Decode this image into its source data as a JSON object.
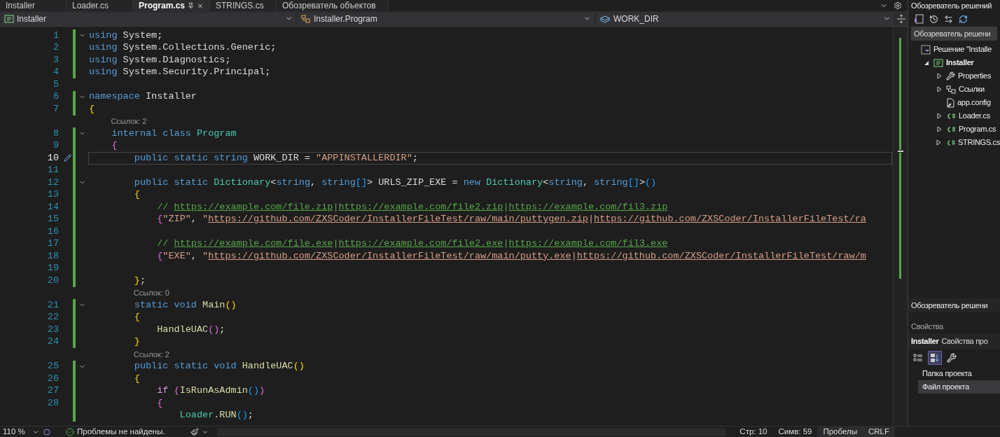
{
  "tabs": [
    {
      "label": "Installer",
      "selected": false
    },
    {
      "label": "Loader.cs",
      "selected": false
    },
    {
      "label": "Program.cs",
      "selected": true
    },
    {
      "label": "STRINGS.cs",
      "selected": false
    },
    {
      "label": "Обозреватель объектов",
      "selected": false
    }
  ],
  "nav": {
    "project": "Installer",
    "class": "Installer.Program",
    "member": "WORK_DIR"
  },
  "code": [
    {
      "kind": "line",
      "num": "1",
      "current": false,
      "changed": true,
      "foldable": true,
      "tokens": [
        {
          "kind": "kw",
          "text": "using"
        },
        {
          "kind": "plain",
          "text": " System;"
        }
      ]
    },
    {
      "kind": "line",
      "num": "2",
      "current": false,
      "changed": true,
      "foldable": false,
      "tokens": [
        {
          "kind": "kw",
          "text": "using"
        },
        {
          "kind": "plain",
          "text": " System.Collections.Generic;"
        }
      ]
    },
    {
      "kind": "line",
      "num": "3",
      "current": false,
      "changed": true,
      "foldable": false,
      "tokens": [
        {
          "kind": "kw",
          "text": "using"
        },
        {
          "kind": "plain",
          "text": " System.Diagnostics;"
        }
      ]
    },
    {
      "kind": "line",
      "num": "4",
      "current": false,
      "changed": true,
      "foldable": false,
      "tokens": [
        {
          "kind": "kw",
          "text": "using"
        },
        {
          "kind": "plain",
          "text": " System.Security.Principal;"
        }
      ]
    },
    {
      "kind": "line",
      "num": "5",
      "current": false,
      "changed": false,
      "foldable": false
    },
    {
      "kind": "line",
      "num": "6",
      "current": false,
      "changed": true,
      "foldable": true,
      "tokens": [
        {
          "kind": "kw",
          "text": "namespace"
        },
        {
          "kind": "plain",
          "text": " Installer"
        }
      ]
    },
    {
      "kind": "line",
      "num": "7",
      "current": false,
      "changed": true,
      "foldable": false,
      "tokens": [
        {
          "kind": "brace1",
          "text": "{"
        }
      ]
    },
    {
      "kind": "lens",
      "text": "    Ссылок: 2"
    },
    {
      "kind": "line",
      "num": "8",
      "current": false,
      "changed": true,
      "foldable": true,
      "tokens": [
        {
          "kind": "kw",
          "text": "    internal class"
        },
        {
          "kind": "type",
          "text": " Program"
        }
      ]
    },
    {
      "kind": "line",
      "num": "9",
      "current": false,
      "changed": true,
      "foldable": false,
      "tokens": [
        {
          "kind": "brace2",
          "text": "    {"
        }
      ]
    },
    {
      "kind": "line",
      "num": "10",
      "current": true,
      "changed": true,
      "foldable": false,
      "tokens": [
        {
          "kind": "kw",
          "text": "        public static string"
        },
        {
          "kind": "plain",
          "text": " WORK_DIR = "
        },
        {
          "kind": "str",
          "text": "\"APPINSTALLERDIR\""
        },
        {
          "kind": "plain",
          "text": ";"
        }
      ]
    },
    {
      "kind": "line",
      "num": "11",
      "current": false,
      "changed": true,
      "foldable": false
    },
    {
      "kind": "line",
      "num": "12",
      "current": false,
      "changed": true,
      "foldable": true,
      "tokens": [
        {
          "kind": "kw",
          "text": "        public static"
        },
        {
          "kind": "type",
          "text": " Dictionary"
        },
        {
          "kind": "plain",
          "text": "<"
        },
        {
          "kind": "kw",
          "text": "string"
        },
        {
          "kind": "plain",
          "text": ", "
        },
        {
          "kind": "kw",
          "text": "string"
        },
        {
          "kind": "brace3",
          "text": "[]"
        },
        {
          "kind": "plain",
          "text": "> URLS_ZIP_EXE = "
        },
        {
          "kind": "kw",
          "text": "new"
        },
        {
          "kind": "type",
          "text": " Dictionary"
        },
        {
          "kind": "plain",
          "text": "<"
        },
        {
          "kind": "kw",
          "text": "string"
        },
        {
          "kind": "plain",
          "text": ", "
        },
        {
          "kind": "kw",
          "text": "string"
        },
        {
          "kind": "brace3",
          "text": "[]"
        },
        {
          "kind": "plain",
          "text": ">"
        },
        {
          "kind": "brace3",
          "text": "()"
        }
      ]
    },
    {
      "kind": "line",
      "num": "13",
      "current": false,
      "changed": true,
      "foldable": false,
      "tokens": [
        {
          "kind": "brace1",
          "text": "        {"
        }
      ]
    },
    {
      "kind": "line",
      "num": "14",
      "current": false,
      "changed": true,
      "foldable": false,
      "tokens": [
        {
          "kind": "comment",
          "text": "            // "
        },
        {
          "kind": "clink",
          "text": "https://example.com/file.zip"
        },
        {
          "kind": "comment",
          "text": "|"
        },
        {
          "kind": "clink",
          "text": "https://example.com/file2.zip"
        },
        {
          "kind": "comment",
          "text": "|"
        },
        {
          "kind": "clink",
          "text": "https://example.com/fil3.zip"
        }
      ]
    },
    {
      "kind": "line",
      "num": "15",
      "current": false,
      "changed": true,
      "foldable": false,
      "tokens": [
        {
          "kind": "brace2",
          "text": "            {"
        },
        {
          "kind": "str",
          "text": "\"ZIP\""
        },
        {
          "kind": "plain",
          "text": ", "
        },
        {
          "kind": "str",
          "text": "\""
        },
        {
          "kind": "slink",
          "text": "https://github.com/ZXSCoder/InstallerFileTest/raw/main/puttygen.zip"
        },
        {
          "kind": "str",
          "text": "|"
        },
        {
          "kind": "slink",
          "text": "https://github.com/ZXSCoder/InstallerFileTest/ra"
        }
      ]
    },
    {
      "kind": "line",
      "num": "16",
      "current": false,
      "changed": true,
      "foldable": false
    },
    {
      "kind": "line",
      "num": "17",
      "current": false,
      "changed": true,
      "foldable": false,
      "tokens": [
        {
          "kind": "comment",
          "text": "            // "
        },
        {
          "kind": "clink",
          "text": "https://example.com/file.exe"
        },
        {
          "kind": "comment",
          "text": "|"
        },
        {
          "kind": "clink",
          "text": "https://example.com/file2.exe"
        },
        {
          "kind": "comment",
          "text": "|"
        },
        {
          "kind": "clink",
          "text": "https://example.com/fil3.exe"
        }
      ]
    },
    {
      "kind": "line",
      "num": "18",
      "current": false,
      "changed": true,
      "foldable": false,
      "tokens": [
        {
          "kind": "brace2",
          "text": "            {"
        },
        {
          "kind": "str",
          "text": "\"EXE\""
        },
        {
          "kind": "plain",
          "text": ", "
        },
        {
          "kind": "str",
          "text": "\""
        },
        {
          "kind": "slink",
          "text": "https://github.com/ZXSCoder/InstallerFileTest/raw/main/putty.exe"
        },
        {
          "kind": "str",
          "text": "|"
        },
        {
          "kind": "slink",
          "text": "https://github.com/ZXSCoder/InstallerFileTest/raw/m"
        }
      ]
    },
    {
      "kind": "line",
      "num": "19",
      "current": false,
      "changed": true,
      "foldable": false
    },
    {
      "kind": "line",
      "num": "20",
      "current": false,
      "changed": true,
      "foldable": false,
      "tokens": [
        {
          "kind": "brace1",
          "text": "        }"
        },
        {
          "kind": "plain",
          "text": ";"
        }
      ]
    },
    {
      "kind": "lens",
      "text": "        Ссылок: 0"
    },
    {
      "kind": "line",
      "num": "21",
      "current": false,
      "changed": true,
      "foldable": true,
      "tokens": [
        {
          "kind": "kw",
          "text": "        static void"
        },
        {
          "kind": "method",
          "text": " Main"
        },
        {
          "kind": "brace1",
          "text": "()"
        }
      ]
    },
    {
      "kind": "line",
      "num": "22",
      "current": false,
      "changed": true,
      "foldable": false,
      "tokens": [
        {
          "kind": "brace1",
          "text": "        {"
        }
      ]
    },
    {
      "kind": "line",
      "num": "23",
      "current": false,
      "changed": true,
      "foldable": false,
      "tokens": [
        {
          "kind": "method",
          "text": "            HandleUAC"
        },
        {
          "kind": "brace2",
          "text": "()"
        },
        {
          "kind": "plain",
          "text": ";"
        }
      ]
    },
    {
      "kind": "line",
      "num": "24",
      "current": false,
      "changed": true,
      "foldable": false,
      "tokens": [
        {
          "kind": "brace1",
          "text": "        }"
        }
      ]
    },
    {
      "kind": "lens",
      "text": "        Ссылок: 2"
    },
    {
      "kind": "line",
      "num": "25",
      "current": false,
      "changed": true,
      "foldable": true,
      "tokens": [
        {
          "kind": "kw",
          "text": "        public static void"
        },
        {
          "kind": "method",
          "text": " HandleUAC"
        },
        {
          "kind": "brace1",
          "text": "()"
        }
      ]
    },
    {
      "kind": "line",
      "num": "26",
      "current": false,
      "changed": true,
      "foldable": false,
      "tokens": [
        {
          "kind": "brace1",
          "text": "        {"
        }
      ]
    },
    {
      "kind": "line",
      "num": "27",
      "current": false,
      "changed": true,
      "foldable": false,
      "tokens": [
        {
          "kind": "ctrl",
          "text": "            if"
        },
        {
          "kind": "brace2",
          "text": " ("
        },
        {
          "kind": "method",
          "text": "IsRunAsAdmin"
        },
        {
          "kind": "brace3",
          "text": "()"
        },
        {
          "kind": "brace2",
          "text": ")"
        }
      ]
    },
    {
      "kind": "line",
      "num": "28",
      "current": false,
      "changed": true,
      "foldable": false,
      "tokens": [
        {
          "kind": "brace2",
          "text": "            {"
        }
      ]
    },
    {
      "kind": "line",
      "current": false,
      "changed": true,
      "foldable": false,
      "tokens": [
        {
          "kind": "type",
          "text": "                Loader"
        },
        {
          "kind": "plain",
          "text": "."
        },
        {
          "kind": "method",
          "text": "RUN"
        },
        {
          "kind": "brace3",
          "text": "()"
        },
        {
          "kind": "plain",
          "text": ";"
        }
      ]
    }
  ],
  "solution_explorer": {
    "title": "Обозреватель решений",
    "search": "Обозреватель решени",
    "tree": [
      {
        "label": "Решение \"Installe",
        "kind": "solution",
        "bold": false,
        "children": [
          {
            "label": "Installer",
            "kind": "project",
            "expanded": true,
            "bold": true,
            "children": [
              {
                "label": "Properties",
                "kind": "properties",
                "expanded": false,
                "bold": false
              },
              {
                "label": "Ссылки",
                "kind": "references",
                "expanded": false,
                "bold": false
              },
              {
                "label": "app.config",
                "kind": "config",
                "bold": false
              },
              {
                "label": "Loader.cs",
                "kind": "source",
                "expanded": false,
                "bold": false
              },
              {
                "label": "Program.cs",
                "kind": "source",
                "expanded": false,
                "bold": false
              },
              {
                "label": "STRINGS.cs",
                "kind": "source",
                "expanded": false,
                "bold": false
              }
            ]
          }
        ]
      }
    ],
    "bottom_tab": "Обозреватель решени"
  },
  "properties": {
    "title": "Свойства",
    "object": "Installer",
    "object_type": "Свойства про",
    "view_buttons": [
      {
        "kind": "categorized",
        "selected": false
      },
      {
        "kind": "alphabetical",
        "selected": true
      },
      {
        "kind": "pages",
        "selected": false
      }
    ],
    "rows": [
      {
        "label": "Папка проекта",
        "selected": false
      },
      {
        "label": "Файл проекта",
        "selected": true
      }
    ]
  },
  "status_bar": {
    "zoom": "110 %",
    "issues": "Проблемы не найдены.",
    "line": "Стр: 10",
    "col": "Симв: 59",
    "indent": "Пробелы",
    "eol": "CRLF"
  }
}
